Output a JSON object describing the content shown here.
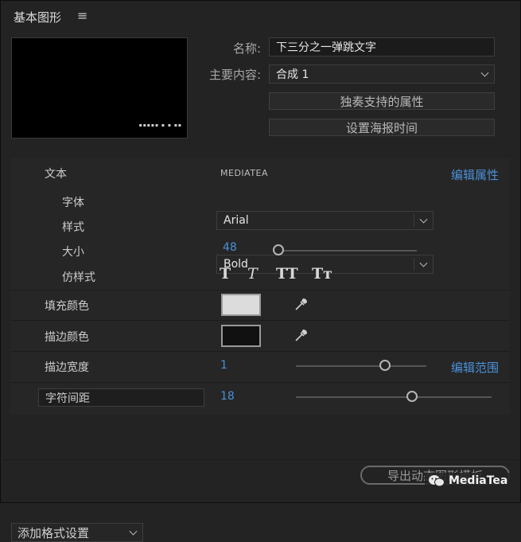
{
  "panel": {
    "title": "基本图形",
    "menu_icon": "≡"
  },
  "preview": {
    "dots": "▪▪▪▪▪ ▪ ▪ ▪▪"
  },
  "props": {
    "name_label": "名称:",
    "name_value": "下三分之一弹跳文字",
    "content_label": "主要内容:",
    "content_value": "合成 1",
    "solo_button": "独奏支持的属性",
    "poster_button": "设置海报时间"
  },
  "text_section": {
    "label": "文本",
    "layer_name": "MEDIATEA",
    "edit_link": "编辑属性",
    "font_label": "字体",
    "font_value": "Arial",
    "style_label": "样式",
    "style_value": "Bold",
    "size_label": "大小",
    "size_value": "48",
    "faux_label": "仿样式",
    "faux_bold": "T",
    "faux_italic": "T",
    "faux_allcaps": "TT",
    "faux_smallcaps": "Tт"
  },
  "fill": {
    "label": "填充颜色",
    "color": "#dcdcdc"
  },
  "stroke_color": {
    "label": "描边颜色",
    "color": "#111111"
  },
  "stroke_width": {
    "label": "描边宽度",
    "value": "1",
    "edit_link": "编辑范围",
    "level": 0.7
  },
  "tracking": {
    "label": "字符间距",
    "value": "18",
    "level": 0.6
  },
  "size_level": 0.0,
  "footer": {
    "add_format": "添加格式设置",
    "export": "导出动态图形模板",
    "watermark": "MediaTea"
  }
}
